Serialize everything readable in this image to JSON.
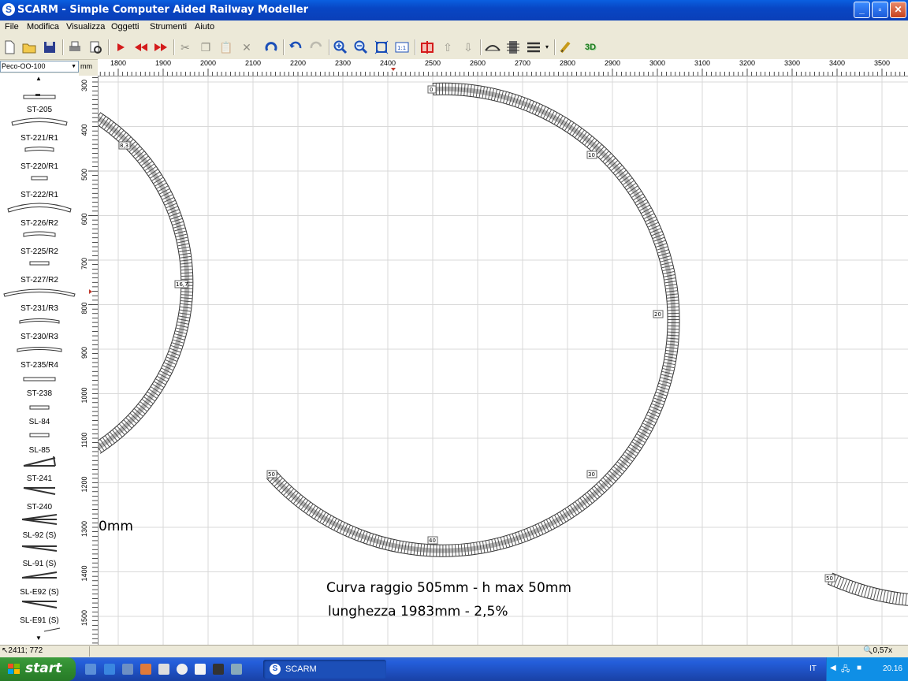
{
  "window": {
    "title": "SCARM - Simple Computer Aided Railway Modeller",
    "icon_letter": "S"
  },
  "menu": [
    "File",
    "Modifica",
    "Visualizza",
    "Oggetti",
    "Strumenti",
    "Aiuto"
  ],
  "toolbar": {
    "three_d_label": "3D"
  },
  "library": {
    "selected": "Peco-OO-100"
  },
  "units": "mm",
  "ruler": {
    "x_ticks": [
      "1800",
      "1900",
      "2000",
      "2100",
      "2200",
      "2300",
      "2400",
      "2500",
      "2600",
      "2700",
      "2800",
      "2900",
      "3000",
      "3100",
      "3200",
      "3300",
      "3400",
      "3500"
    ],
    "y_ticks": [
      "300",
      "400",
      "500",
      "600",
      "700",
      "800",
      "900",
      "1000",
      "1100",
      "1200",
      "1300",
      "1400",
      "1500"
    ]
  },
  "palette": [
    "ST-205",
    "ST-221/R1",
    "ST-220/R1",
    "ST-222/R1",
    "ST-226/R2",
    "ST-225/R2",
    "ST-227/R2",
    "ST-231/R3",
    "ST-230/R3",
    "ST-235/R4",
    "ST-238",
    "SL-84",
    "SL-85",
    "ST-241",
    "ST-240",
    "SL-92 (S)",
    "SL-91 (S)",
    "SL-E92 (S)",
    "SL-E91 (S)"
  ],
  "canvas": {
    "partial_text": "0mm",
    "note_line1": "Curva raggio 505mm - h max 50mm",
    "note_line2": "lunghezza 1983mm - 2,5%",
    "markers": [
      "0",
      "10",
      "20",
      "30",
      "40",
      "50",
      "8,3",
      "16,7",
      "50"
    ]
  },
  "status": {
    "coordinates": "2411; 772",
    "zoom": "0,57x"
  },
  "taskbar": {
    "start_label": "start",
    "task_label": "SCARM",
    "language": "IT",
    "clock": "20.16"
  }
}
